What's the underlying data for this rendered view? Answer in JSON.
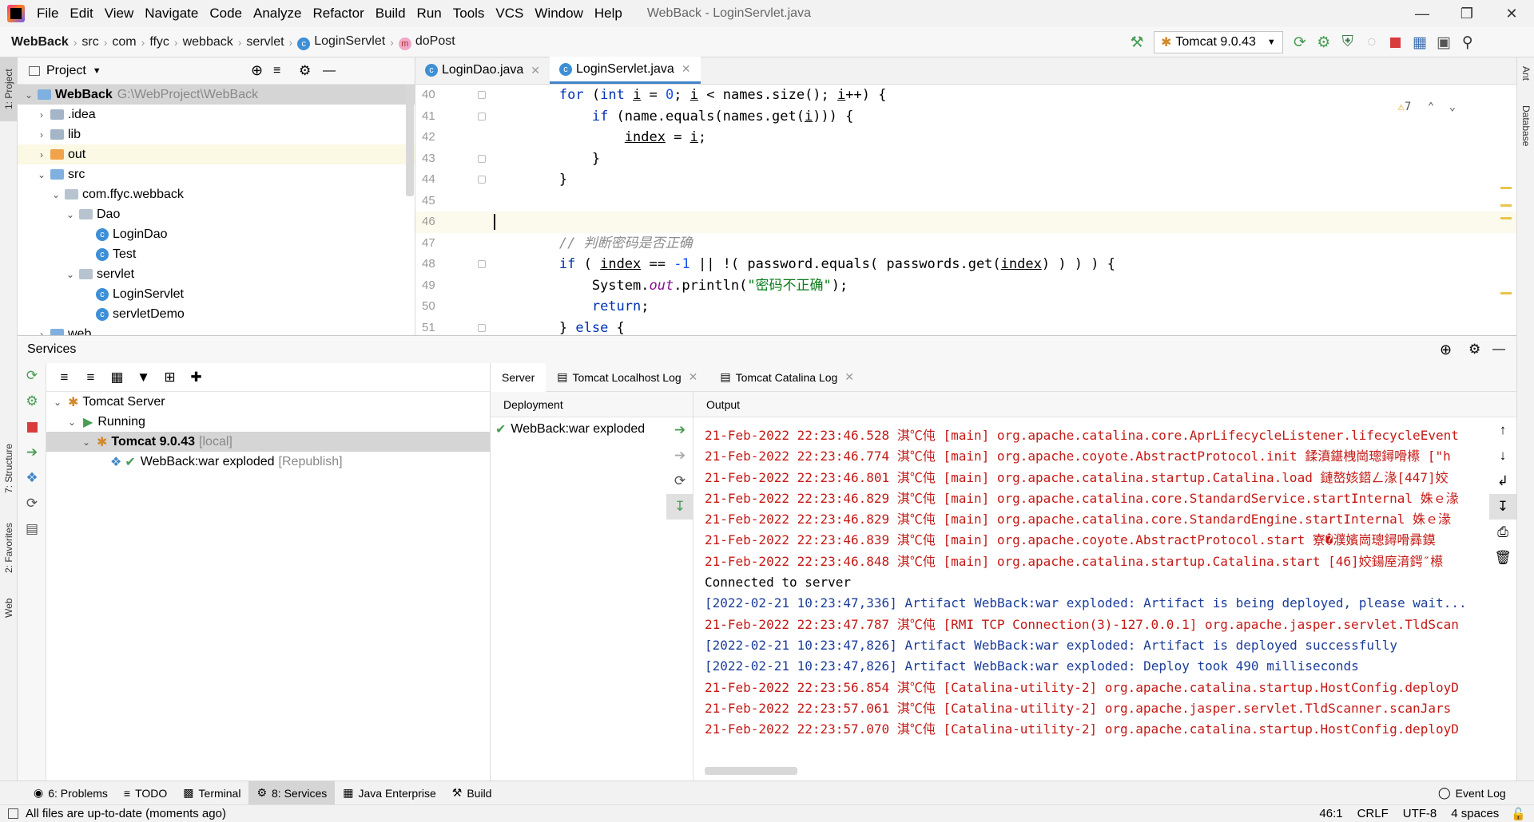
{
  "window": {
    "title": "WebBack - LoginServlet.java",
    "menu": [
      "File",
      "Edit",
      "View",
      "Navigate",
      "Code",
      "Analyze",
      "Refactor",
      "Build",
      "Run",
      "Tools",
      "VCS",
      "Window",
      "Help"
    ]
  },
  "navbar": {
    "breadcrumbs": [
      "WebBack",
      "src",
      "com",
      "ffyc",
      "webback",
      "servlet",
      "LoginServlet",
      "doPost"
    ],
    "run_config": "Tomcat 9.0.43"
  },
  "left_stripe": {
    "project": "1: Project",
    "structure": "7: Structure",
    "favorites": "2: Favorites",
    "web": "Web"
  },
  "right_stripe": {
    "ant": "Ant",
    "database": "Database"
  },
  "project": {
    "title": "Project",
    "root_name": "WebBack",
    "root_path": "G:\\WebProject\\WebBack",
    "items": [
      ".idea",
      "lib",
      "out",
      "src",
      "com.ffyc.webback",
      "Dao",
      "LoginDao",
      "Test",
      "servlet",
      "LoginServlet",
      "servletDemo",
      "web"
    ]
  },
  "editor": {
    "tabs": [
      "LoginDao.java",
      "LoginServlet.java"
    ],
    "line_numbers": [
      "40",
      "41",
      "42",
      "43",
      "44",
      "45",
      "46",
      "47",
      "48",
      "49",
      "50",
      "51"
    ],
    "warnings": "7",
    "comment": "// 判断密码是否正确",
    "string_literal": "\"密码不正确\""
  },
  "services": {
    "title": "Services",
    "tree": {
      "server": "Tomcat Server",
      "state": "Running",
      "instance": "Tomcat 9.0.43",
      "instance_tag": "[local]",
      "artifact": "WebBack:war exploded",
      "artifact_tag": "[Republish]"
    },
    "tabs": [
      "Server",
      "Tomcat Localhost Log",
      "Tomcat Catalina Log"
    ],
    "deployment_header": "Deployment",
    "deployment_item": "WebBack:war exploded",
    "output_header": "Output",
    "log": [
      {
        "c": "lr",
        "t": "21-Feb-2022 22:23:46.528 淇℃伅 [main] org.apache.catalina.core.AprLifecycleListener.lifecycleEvent"
      },
      {
        "c": "lr",
        "t": "21-Feb-2022 22:23:46.774 淇℃伅 [main] org.apache.coyote.AbstractProtocol.init 鍒濆鍖栧崗璁鐞嗗櫒 [\"h"
      },
      {
        "c": "lr",
        "t": "21-Feb-2022 22:23:46.801 淇℃伅 [main] org.apache.catalina.startup.Catalina.load 鏈嶅姟鍣ㄥ湪[447]姣"
      },
      {
        "c": "lr",
        "t": "21-Feb-2022 22:23:46.829 淇℃伅 [main] org.apache.catalina.core.StandardService.startInternal 姝ｅ湪"
      },
      {
        "c": "lr",
        "t": "21-Feb-2022 22:23:46.829 淇℃伅 [main] org.apache.catalina.core.StandardEngine.startInternal 姝ｅ湪"
      },
      {
        "c": "lr",
        "t": "21-Feb-2022 22:23:46.839 淇℃伅 [main] org.apache.coyote.AbstractProtocol.start 寮�濮嬪崗璁鐞嗗彞鏌"
      },
      {
        "c": "lr",
        "t": "21-Feb-2022 22:23:46.848 淇℃伅 [main] org.apache.catalina.startup.Catalina.start [46]姣鍚庢湇鍔″櫒"
      },
      {
        "c": "lk",
        "t": "Connected to server"
      },
      {
        "c": "lb",
        "t": "[2022-02-21 10:23:47,336] Artifact WebBack:war exploded: Artifact is being deployed, please wait..."
      },
      {
        "c": "lr",
        "t": "21-Feb-2022 22:23:47.787 淇℃伅 [RMI TCP Connection(3)-127.0.0.1] org.apache.jasper.servlet.TldScan"
      },
      {
        "c": "lb",
        "t": "[2022-02-21 10:23:47,826] Artifact WebBack:war exploded: Artifact is deployed successfully"
      },
      {
        "c": "lb",
        "t": "[2022-02-21 10:23:47,826] Artifact WebBack:war exploded: Deploy took 490 milliseconds"
      },
      {
        "c": "lr",
        "t": "21-Feb-2022 22:23:56.854 淇℃伅 [Catalina-utility-2] org.apache.catalina.startup.HostConfig.deployD"
      },
      {
        "c": "lr",
        "t": "21-Feb-2022 22:23:57.061 淇℃伅 [Catalina-utility-2] org.apache.jasper.servlet.TldScanner.scanJars"
      },
      {
        "c": "lr",
        "t": "21-Feb-2022 22:23:57.070 淇℃伅 [Catalina-utility-2] org.apache.catalina.startup.HostConfig.deployD"
      }
    ]
  },
  "bottom_tabs": [
    "6: Problems",
    "TODO",
    "Terminal",
    "8: Services",
    "Java Enterprise",
    "Build",
    "Event Log"
  ],
  "status": {
    "message": "All files are up-to-date (moments ago)",
    "position": "46:1",
    "line_sep": "CRLF",
    "encoding": "UTF-8",
    "indent": "4 spaces"
  },
  "colors": {
    "accent": "#4083c9",
    "log_red": "#c41a16",
    "log_blue": "#1c3d9a",
    "keyword": "#0033b3"
  }
}
